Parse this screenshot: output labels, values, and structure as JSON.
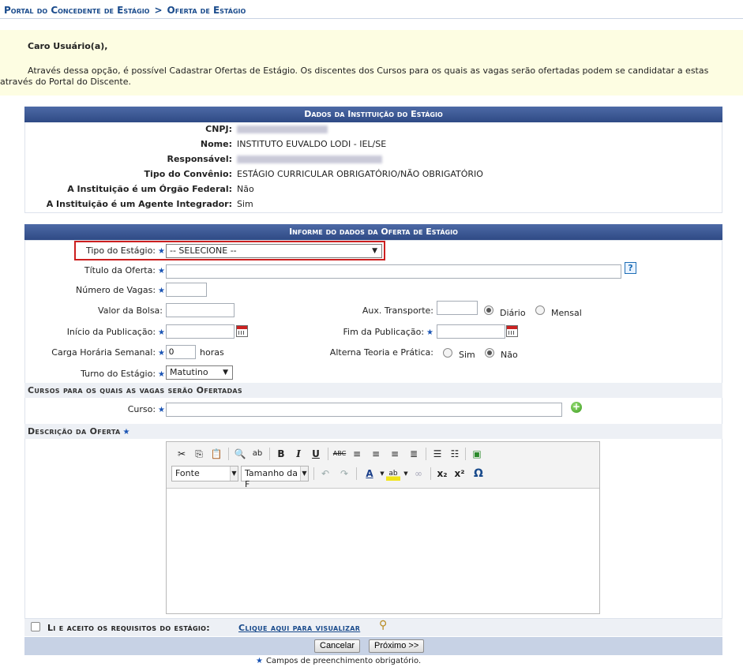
{
  "breadcrumb": {
    "portal": "Portal do Concedente de Estágio",
    "separator": ">",
    "current": "Oferta de Estágio"
  },
  "notice": {
    "greeting": "Caro Usuário(a),",
    "message": "Através dessa opção, é possível Cadastrar Ofertas de Estágio. Os discentes dos Cursos para os quais as vagas serão ofertadas podem se candidatar a estas através do Portal do Discente."
  },
  "institution": {
    "header": "Dados da Instituição do Estágio",
    "fields": [
      {
        "label": "CNPJ:",
        "value": ""
      },
      {
        "label": "Nome:",
        "value": "INSTITUTO EUVALDO LODI - IEL/SE"
      },
      {
        "label": "Responsável:",
        "value": ""
      },
      {
        "label": "Tipo do Convênio:",
        "value": "ESTÁGIO CURRICULAR OBRIGATÓRIO/NÃO OBRIGATÓRIO"
      },
      {
        "label": "A Instituição é um Órgão Federal:",
        "value": "Não"
      },
      {
        "label": "A Instituição é um Agente Integrador:",
        "value": "Sim"
      }
    ]
  },
  "form": {
    "header": "Informe do dados da Oferta de Estágio",
    "tipo_estagio": {
      "label": "Tipo do Estágio:",
      "value": "-- SELECIONE --"
    },
    "titulo": {
      "label": "Título da Oferta:",
      "value": ""
    },
    "vagas": {
      "label": "Número de Vagas:",
      "value": ""
    },
    "bolsa": {
      "label": "Valor da Bolsa:",
      "value": ""
    },
    "aux_transporte": {
      "label": "Aux. Transporte:",
      "value": "",
      "opt_diario": "Diário",
      "opt_mensal": "Mensal",
      "selected": "Diário"
    },
    "inicio_pub": {
      "label": "Início da Publicação:",
      "value": ""
    },
    "fim_pub": {
      "label": "Fim da Publicação:",
      "value": ""
    },
    "carga": {
      "label": "Carga Horária Semanal:",
      "value": "0",
      "unit": "horas"
    },
    "alterna": {
      "label": "Alterna Teoria e Prática:",
      "opt_sim": "Sim",
      "opt_nao": "Não",
      "selected": "Não"
    },
    "turno": {
      "label": "Turno do Estágio:",
      "value": "Matutino"
    },
    "required_star": "★"
  },
  "cursos": {
    "header": "Cursos para os quais as vagas serão Ofertadas",
    "label": "Curso:",
    "value": ""
  },
  "descricao": {
    "header": "Descrição da Oferta",
    "font_select": "Fonte",
    "size_select": "Tamanho da F",
    "toolbar_row1": [
      "cut-icon",
      "copy-icon",
      "paste-icon",
      "find-icon",
      "replace-icon",
      "bold-icon",
      "italic-icon",
      "underline-icon",
      "strikethrough-icon",
      "align-left-icon",
      "align-center-icon",
      "align-right-icon",
      "align-justify-icon",
      "bullet-list-icon",
      "numbered-list-icon",
      "image-icon"
    ],
    "toolbar_row2": [
      "undo-icon",
      "redo-icon",
      "text-color-icon",
      "highlight-icon",
      "link-icon",
      "subscript-icon",
      "superscript-icon",
      "omega-icon"
    ]
  },
  "bottom": {
    "terms_label": "Li e aceito os requisitos do estágio:",
    "terms_link": "Clique aqui para visualizar",
    "cancel": "Cancelar",
    "next": "Próximo >>",
    "footnote": "Campos de preenchimento obrigatório."
  },
  "colors": {
    "header_bg": "#3b5997",
    "notice_bg": "#fdfde2",
    "link": "#1a4b8c",
    "highlight_border": "#cc0000"
  }
}
